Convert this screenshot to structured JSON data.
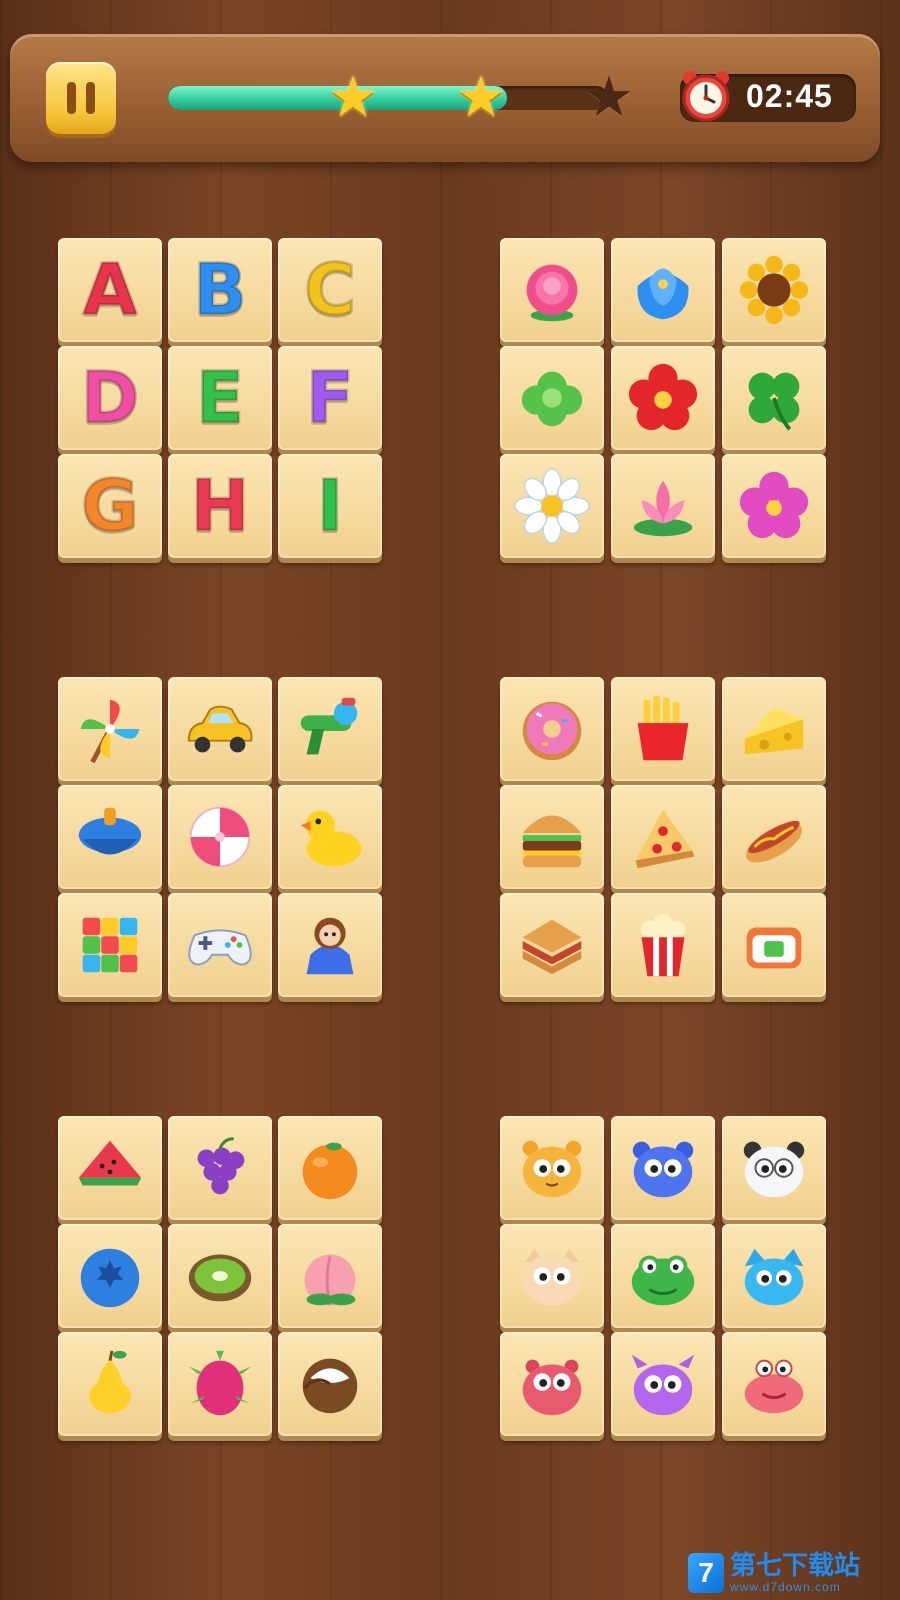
{
  "hud": {
    "timer": "02:45",
    "progress_fraction": 0.77,
    "stars": [
      {
        "name": "star-1",
        "earned": true
      },
      {
        "name": "star-2",
        "earned": true
      },
      {
        "name": "star-3",
        "earned": false
      }
    ]
  },
  "letters": [
    {
      "ch": "A",
      "color": "#e8344a"
    },
    {
      "ch": "B",
      "color": "#2f8ff0"
    },
    {
      "ch": "C",
      "color": "#f1c31b"
    },
    {
      "ch": "D",
      "color": "#ef4fa3"
    },
    {
      "ch": "E",
      "color": "#33c04a"
    },
    {
      "ch": "F",
      "color": "#a05af0"
    },
    {
      "ch": "G",
      "color": "#f3862a"
    },
    {
      "ch": "H",
      "color": "#e93b54"
    },
    {
      "ch": "I",
      "color": "#2fbf4d"
    }
  ],
  "groups": {
    "flowers": [
      "pink-peony",
      "blue-tulip",
      "sunflower",
      "green-succulent",
      "red-flower",
      "four-leaf-clover",
      "white-daisy",
      "pink-lotus",
      "magenta-flower"
    ],
    "toys": [
      "pinwheel",
      "toy-car",
      "water-gun",
      "spinning-top",
      "beach-ball",
      "rubber-duck",
      "rubik-cube",
      "game-controller",
      "doll"
    ],
    "food": [
      "donut",
      "french-fries",
      "cheese",
      "burger",
      "pizza-slice",
      "hot-dog",
      "sandwich",
      "popcorn",
      "sushi-roll"
    ],
    "fruits": [
      "watermelon",
      "grapes",
      "orange",
      "blueberry",
      "kiwi",
      "peach",
      "pear",
      "dragon-fruit",
      "coconut"
    ],
    "animals": [
      "tiger",
      "blue-bear",
      "panda",
      "cat",
      "frog",
      "blue-cat",
      "hippo",
      "purple-cow",
      "crab"
    ]
  },
  "watermark": {
    "title": "第七下载站",
    "url": "www.d7down.com",
    "logo": "7"
  }
}
